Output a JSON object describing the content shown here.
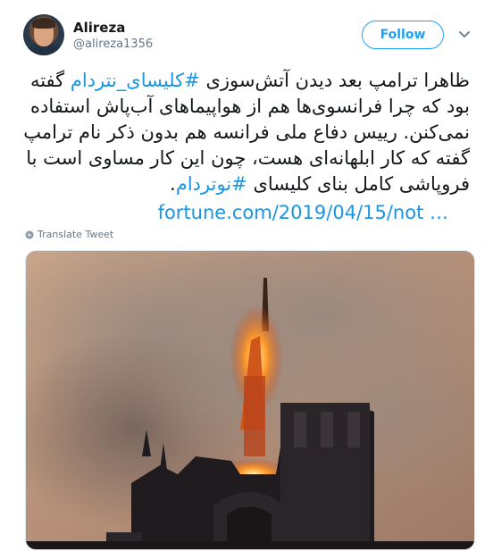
{
  "user": {
    "display_name": "Alireza",
    "handle": "@alireza1356"
  },
  "follow_button": {
    "label": "Follow"
  },
  "tweet": {
    "line1_before": "ظاهرا ترامپ بعد دیدن آتش‌سوزی ",
    "hashtag1": "#کلیسای_نتردام",
    "line1_after": " گفته بود که چرا فرانسوی‌ها هم از هواپیماهای آب‌پاش استفاده نمی‌کنن. رییس دفاع ملی فرانسه هم بدون ذکر نام ترامپ گفته که کار ابلهانه‌ای هست، چون این کار مساوی است با فروپاشی کامل بنای کلیسای ",
    "hashtag2": "#نوتردام",
    "line_end": ".",
    "link": "fortune.com/2019/04/15/not …"
  },
  "translate_label": "Translate Tweet",
  "colors": {
    "accent": "#1da1f2",
    "link": "#1b95e0",
    "secondary_text": "#657786"
  },
  "icons": {
    "more": "chevron-down-icon",
    "translate": "globe-icon"
  }
}
